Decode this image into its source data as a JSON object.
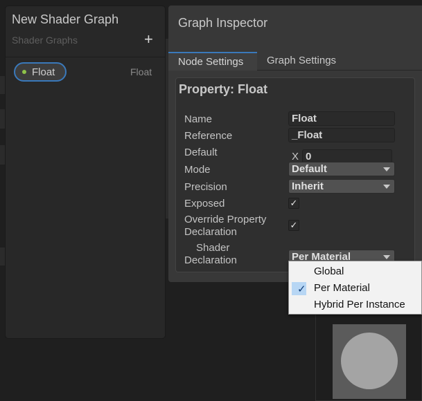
{
  "blackboard": {
    "title": "New Shader Graph",
    "subtitle": "Shader Graphs",
    "add_glyph": "+",
    "property": {
      "name": "Float",
      "type": "Float",
      "dot_color": "#8fc34a"
    }
  },
  "inspector": {
    "title": "Graph Inspector",
    "tabs": [
      "Node Settings",
      "Graph Settings"
    ],
    "active_tab": "Node Settings",
    "property_header": "Property: Float",
    "labels": {
      "name": "Name",
      "reference": "Reference",
      "default": "Default",
      "mode": "Mode",
      "precision": "Precision",
      "exposed": "Exposed",
      "override_line1": "Override Property",
      "override_line2": "Declaration",
      "shader_line1": "Shader",
      "shader_line2": "Declaration"
    },
    "values": {
      "name": "Float",
      "reference": "_Float",
      "default_axis": "X",
      "default_value": "0",
      "mode": "Default",
      "precision": "Inherit",
      "exposed": "✓",
      "override": "✓",
      "shader_declaration": "Per Material"
    }
  },
  "dropdown_menu": {
    "items": [
      "Global",
      "Per Material",
      "Hybrid Per Instance"
    ],
    "selected": "Per Material",
    "check_glyph": "✓"
  },
  "colors": {
    "accent": "#3a79bb",
    "highlight": "#b7d6f4"
  }
}
